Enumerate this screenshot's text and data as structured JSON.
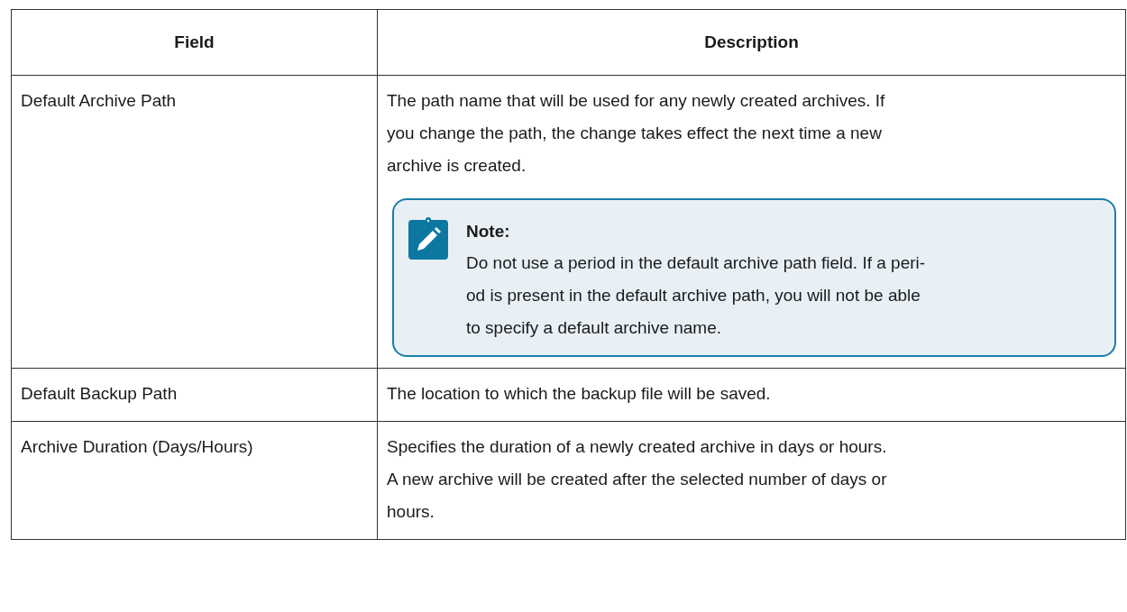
{
  "table": {
    "columns": [
      "Field",
      "Description"
    ],
    "rows": [
      {
        "field": "Default Archive Path",
        "description": [
          "The path name that will be used for any newly created archives. If",
          "you change the path, the change takes effect the next time a new",
          "archive is created."
        ],
        "note": {
          "title": "Note:",
          "lines": [
            "Do not use a period in the default archive path field. If a peri-",
            "od is present in the default archive path, you will not be able",
            "to specify a default archive name."
          ]
        }
      },
      {
        "field": "Default Backup Path",
        "description": [
          "The location to which the backup file will be saved."
        ]
      },
      {
        "field": "Archive Duration (Days/Hours)",
        "description": [
          "Specifies the duration of a newly created archive in days or hours.",
          "A new archive will be created after the selected number of days or",
          "hours."
        ]
      }
    ]
  }
}
